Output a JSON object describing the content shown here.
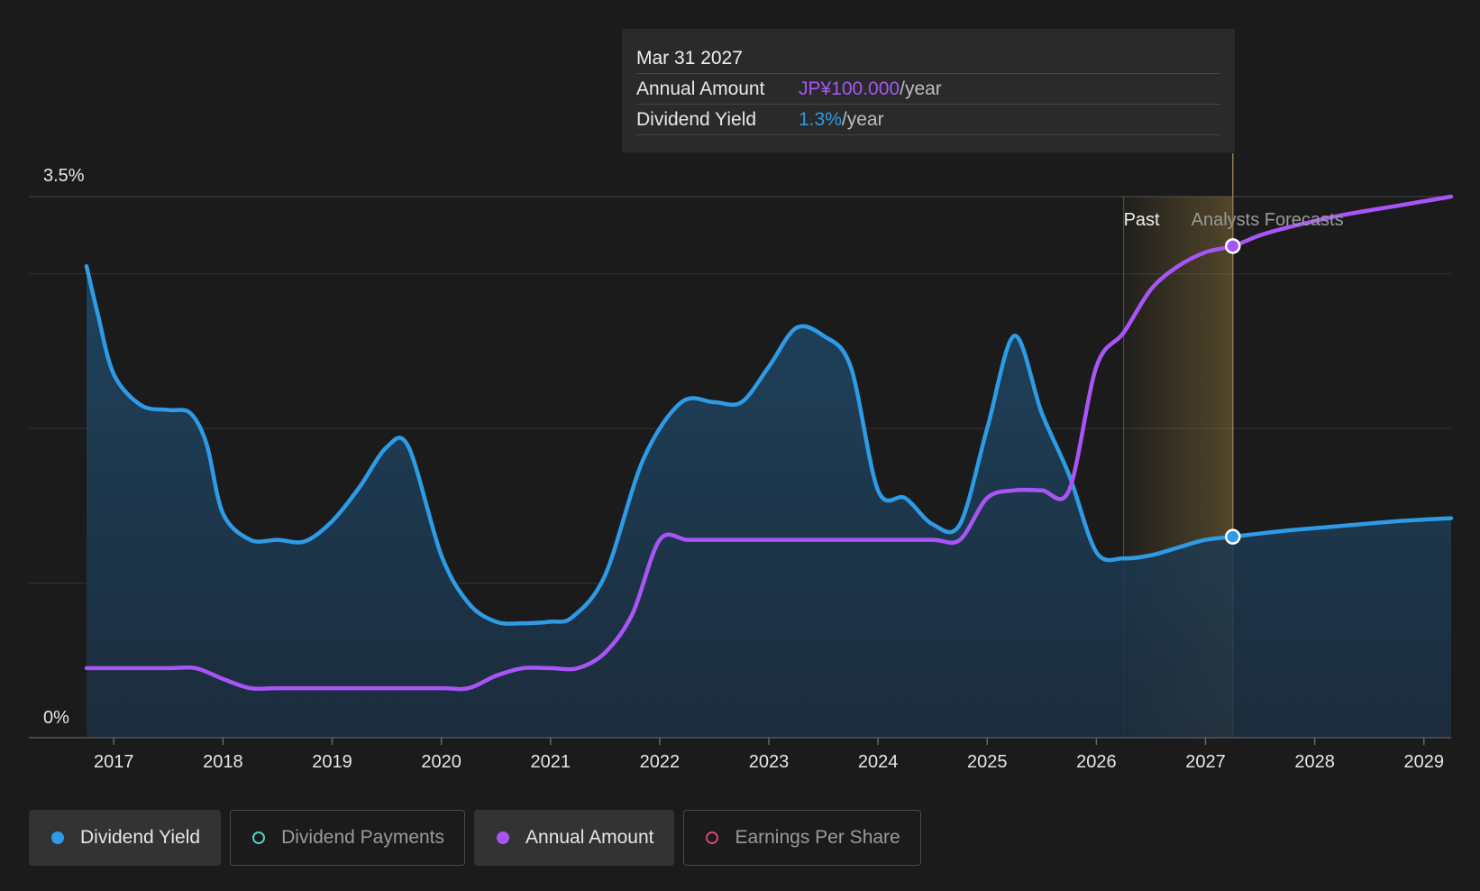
{
  "tooltip": {
    "date": "Mar 31 2027",
    "rows": [
      {
        "label": "Annual Amount",
        "value": "JP¥100.000",
        "unit": "/year",
        "color": "#a855f7"
      },
      {
        "label": "Dividend Yield",
        "value": "1.3%",
        "unit": "/year",
        "color": "#2d9be6"
      }
    ]
  },
  "legend": [
    {
      "label": "Dividend Yield",
      "color": "#2d9be6",
      "active": true
    },
    {
      "label": "Dividend Payments",
      "color": "#4fd1c5",
      "active": false
    },
    {
      "label": "Annual Amount",
      "color": "#a855f7",
      "active": true
    },
    {
      "label": "Earnings Per Share",
      "color": "#d0457a",
      "active": false
    }
  ],
  "chart_data": {
    "type": "line",
    "x_ticks": [
      "2017",
      "2018",
      "2019",
      "2020",
      "2021",
      "2022",
      "2023",
      "2024",
      "2025",
      "2026",
      "2027",
      "2028",
      "2029"
    ],
    "y_ticks": [
      "0%",
      "3.5%"
    ],
    "ylim": [
      0,
      3.5
    ],
    "xlim": [
      2016.75,
      2029.25
    ],
    "grid": true,
    "labels": {
      "past": "Past",
      "forecast": "Analysts Forecasts"
    },
    "past_end": 2026.25,
    "forecast_start": 2027.25,
    "highlight": {
      "x": 2027.25,
      "yield": 1.3,
      "amount_pct": 3.18
    },
    "series": [
      {
        "name": "Dividend Yield",
        "color": "#2d9be6",
        "points": [
          [
            2016.75,
            3.05
          ],
          [
            2016.85,
            2.75
          ],
          [
            2017.0,
            2.35
          ],
          [
            2017.25,
            2.15
          ],
          [
            2017.5,
            2.12
          ],
          [
            2017.7,
            2.1
          ],
          [
            2017.85,
            1.9
          ],
          [
            2018.0,
            1.45
          ],
          [
            2018.25,
            1.28
          ],
          [
            2018.5,
            1.28
          ],
          [
            2018.75,
            1.27
          ],
          [
            2019.0,
            1.4
          ],
          [
            2019.25,
            1.62
          ],
          [
            2019.5,
            1.88
          ],
          [
            2019.7,
            1.88
          ],
          [
            2020.0,
            1.18
          ],
          [
            2020.25,
            0.87
          ],
          [
            2020.5,
            0.75
          ],
          [
            2020.75,
            0.74
          ],
          [
            2021.0,
            0.75
          ],
          [
            2021.2,
            0.78
          ],
          [
            2021.5,
            1.05
          ],
          [
            2021.85,
            1.8
          ],
          [
            2022.2,
            2.17
          ],
          [
            2022.5,
            2.17
          ],
          [
            2022.75,
            2.17
          ],
          [
            2023.0,
            2.4
          ],
          [
            2023.25,
            2.65
          ],
          [
            2023.5,
            2.6
          ],
          [
            2023.75,
            2.4
          ],
          [
            2024.0,
            1.6
          ],
          [
            2024.25,
            1.55
          ],
          [
            2024.5,
            1.38
          ],
          [
            2024.75,
            1.38
          ],
          [
            2025.0,
            2.0
          ],
          [
            2025.25,
            2.6
          ],
          [
            2025.5,
            2.1
          ],
          [
            2025.75,
            1.7
          ],
          [
            2026.0,
            1.2
          ],
          [
            2026.25,
            1.16
          ],
          [
            2026.5,
            1.18
          ],
          [
            2026.75,
            1.23
          ],
          [
            2027.0,
            1.28
          ],
          [
            2027.25,
            1.3
          ],
          [
            2027.75,
            1.34
          ],
          [
            2028.25,
            1.37
          ],
          [
            2028.75,
            1.4
          ],
          [
            2029.25,
            1.42
          ]
        ]
      },
      {
        "name": "Annual Amount",
        "color": "#a855f7",
        "points": [
          [
            2016.75,
            0.45
          ],
          [
            2017.0,
            0.45
          ],
          [
            2017.5,
            0.45
          ],
          [
            2017.75,
            0.45
          ],
          [
            2018.0,
            0.38
          ],
          [
            2018.25,
            0.32
          ],
          [
            2018.5,
            0.32
          ],
          [
            2019.0,
            0.32
          ],
          [
            2019.5,
            0.32
          ],
          [
            2020.0,
            0.32
          ],
          [
            2020.25,
            0.32
          ],
          [
            2020.5,
            0.4
          ],
          [
            2020.75,
            0.45
          ],
          [
            2021.0,
            0.45
          ],
          [
            2021.25,
            0.45
          ],
          [
            2021.5,
            0.55
          ],
          [
            2021.75,
            0.8
          ],
          [
            2022.0,
            1.28
          ],
          [
            2022.25,
            1.28
          ],
          [
            2022.5,
            1.28
          ],
          [
            2023.0,
            1.28
          ],
          [
            2023.5,
            1.28
          ],
          [
            2024.0,
            1.28
          ],
          [
            2024.5,
            1.28
          ],
          [
            2024.75,
            1.28
          ],
          [
            2025.0,
            1.55
          ],
          [
            2025.25,
            1.6
          ],
          [
            2025.5,
            1.6
          ],
          [
            2025.75,
            1.6
          ],
          [
            2026.0,
            2.4
          ],
          [
            2026.25,
            2.62
          ],
          [
            2026.5,
            2.9
          ],
          [
            2026.75,
            3.05
          ],
          [
            2027.0,
            3.14
          ],
          [
            2027.25,
            3.18
          ],
          [
            2027.5,
            3.25
          ],
          [
            2027.75,
            3.3
          ],
          [
            2028.25,
            3.38
          ],
          [
            2028.75,
            3.44
          ],
          [
            2029.25,
            3.5
          ]
        ]
      }
    ]
  }
}
